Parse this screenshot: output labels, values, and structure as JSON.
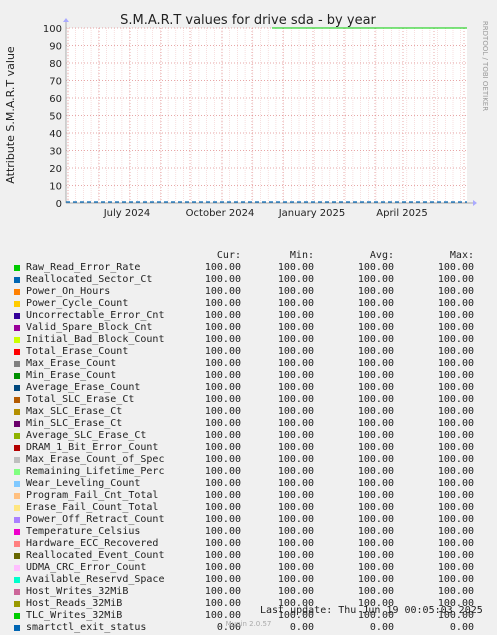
{
  "chart_data": {
    "type": "line",
    "title": "S.M.A.R.T values for drive sda - by year",
    "ylabel": "Attribute S.M.A.R.T value",
    "xlabel": "",
    "ylim": [
      0,
      100
    ],
    "y_ticks": [
      "0",
      "10",
      "20",
      "30",
      "40",
      "50",
      "60",
      "70",
      "80",
      "90",
      "100"
    ],
    "x_ticks": [
      "July 2024",
      "October 2024",
      "January 2025",
      "April 2025"
    ],
    "side_text": "RRDTOOL / TOBI OETIKER",
    "columns": [
      "Cur:",
      "Min:",
      "Avg:",
      "Max:"
    ],
    "visible_line": {
      "name": "Raw_Read_Error_Rate",
      "value": 100,
      "start": "January 2025",
      "color": "#00cc00"
    },
    "series": [
      {
        "name": "Raw_Read_Error_Rate",
        "color": "#00cc00",
        "cur": "100.00",
        "min": "100.00",
        "avg": "100.00",
        "max": "100.00"
      },
      {
        "name": "Reallocated_Sector_Ct",
        "color": "#0066b3",
        "cur": "100.00",
        "min": "100.00",
        "avg": "100.00",
        "max": "100.00"
      },
      {
        "name": "Power_On_Hours",
        "color": "#ff8000",
        "cur": "100.00",
        "min": "100.00",
        "avg": "100.00",
        "max": "100.00"
      },
      {
        "name": "Power_Cycle_Count",
        "color": "#ffcc00",
        "cur": "100.00",
        "min": "100.00",
        "avg": "100.00",
        "max": "100.00"
      },
      {
        "name": "Uncorrectable_Error_Cnt",
        "color": "#330099",
        "cur": "100.00",
        "min": "100.00",
        "avg": "100.00",
        "max": "100.00"
      },
      {
        "name": "Valid_Spare_Block_Cnt",
        "color": "#990099",
        "cur": "100.00",
        "min": "100.00",
        "avg": "100.00",
        "max": "100.00"
      },
      {
        "name": "Initial_Bad_Block_Count",
        "color": "#ccff00",
        "cur": "100.00",
        "min": "100.00",
        "avg": "100.00",
        "max": "100.00"
      },
      {
        "name": "Total_Erase_Count",
        "color": "#ff0000",
        "cur": "100.00",
        "min": "100.00",
        "avg": "100.00",
        "max": "100.00"
      },
      {
        "name": "Max_Erase_Count",
        "color": "#808080",
        "cur": "100.00",
        "min": "100.00",
        "avg": "100.00",
        "max": "100.00"
      },
      {
        "name": "Min_Erase_Count",
        "color": "#008f00",
        "cur": "100.00",
        "min": "100.00",
        "avg": "100.00",
        "max": "100.00"
      },
      {
        "name": "Average_Erase_Count",
        "color": "#00487d",
        "cur": "100.00",
        "min": "100.00",
        "avg": "100.00",
        "max": "100.00"
      },
      {
        "name": "Total_SLC_Erase_Ct",
        "color": "#b35a00",
        "cur": "100.00",
        "min": "100.00",
        "avg": "100.00",
        "max": "100.00"
      },
      {
        "name": "Max_SLC_Erase_Ct",
        "color": "#b38f00",
        "cur": "100.00",
        "min": "100.00",
        "avg": "100.00",
        "max": "100.00"
      },
      {
        "name": "Min_SLC_Erase_Ct",
        "color": "#6b006b",
        "cur": "100.00",
        "min": "100.00",
        "avg": "100.00",
        "max": "100.00"
      },
      {
        "name": "Average_SLC_Erase_Ct",
        "color": "#8fb300",
        "cur": "100.00",
        "min": "100.00",
        "avg": "100.00",
        "max": "100.00"
      },
      {
        "name": "DRAM_1_Bit_Error_Count",
        "color": "#b30000",
        "cur": "100.00",
        "min": "100.00",
        "avg": "100.00",
        "max": "100.00"
      },
      {
        "name": "Max_Erase_Count_of_Spec",
        "color": "#bebebe",
        "cur": "100.00",
        "min": "100.00",
        "avg": "100.00",
        "max": "100.00"
      },
      {
        "name": "Remaining_Lifetime_Perc",
        "color": "#80ff80",
        "cur": "100.00",
        "min": "100.00",
        "avg": "100.00",
        "max": "100.00"
      },
      {
        "name": "Wear_Leveling_Count",
        "color": "#80c9ff",
        "cur": "100.00",
        "min": "100.00",
        "avg": "100.00",
        "max": "100.00"
      },
      {
        "name": "Program_Fail_Cnt_Total",
        "color": "#ffc080",
        "cur": "100.00",
        "min": "100.00",
        "avg": "100.00",
        "max": "100.00"
      },
      {
        "name": "Erase_Fail_Count_Total",
        "color": "#ffe680",
        "cur": "100.00",
        "min": "100.00",
        "avg": "100.00",
        "max": "100.00"
      },
      {
        "name": "Power_Off_Retract_Count",
        "color": "#aa80ff",
        "cur": "100.00",
        "min": "100.00",
        "avg": "100.00",
        "max": "100.00"
      },
      {
        "name": "Temperature_Celsius",
        "color": "#ee00cc",
        "cur": "100.00",
        "min": "100.00",
        "avg": "100.00",
        "max": "100.00"
      },
      {
        "name": "Hardware_ECC_Recovered",
        "color": "#ff8080",
        "cur": "100.00",
        "min": "100.00",
        "avg": "100.00",
        "max": "100.00"
      },
      {
        "name": "Reallocated_Event_Count",
        "color": "#666600",
        "cur": "100.00",
        "min": "100.00",
        "avg": "100.00",
        "max": "100.00"
      },
      {
        "name": "UDMA_CRC_Error_Count",
        "color": "#ffbfff",
        "cur": "100.00",
        "min": "100.00",
        "avg": "100.00",
        "max": "100.00"
      },
      {
        "name": "Available_Reservd_Space",
        "color": "#00ffcc",
        "cur": "100.00",
        "min": "100.00",
        "avg": "100.00",
        "max": "100.00"
      },
      {
        "name": "Host_Writes_32MiB",
        "color": "#cc6699",
        "cur": "100.00",
        "min": "100.00",
        "avg": "100.00",
        "max": "100.00"
      },
      {
        "name": "Host_Reads_32MiB",
        "color": "#999900",
        "cur": "100.00",
        "min": "100.00",
        "avg": "100.00",
        "max": "100.00"
      },
      {
        "name": "TLC_Writes_32MiB",
        "color": "#00cc00",
        "cur": "100.00",
        "min": "100.00",
        "avg": "100.00",
        "max": "100.00"
      },
      {
        "name": "smartctl_exit_status",
        "color": "#0066b3",
        "cur": "0.00",
        "min": "0.00",
        "avg": "0.00",
        "max": "0.00"
      }
    ]
  },
  "last_update": "Last update: Thu Jun 19 00:05:03 2025",
  "footer": "Munin 2.0.57"
}
